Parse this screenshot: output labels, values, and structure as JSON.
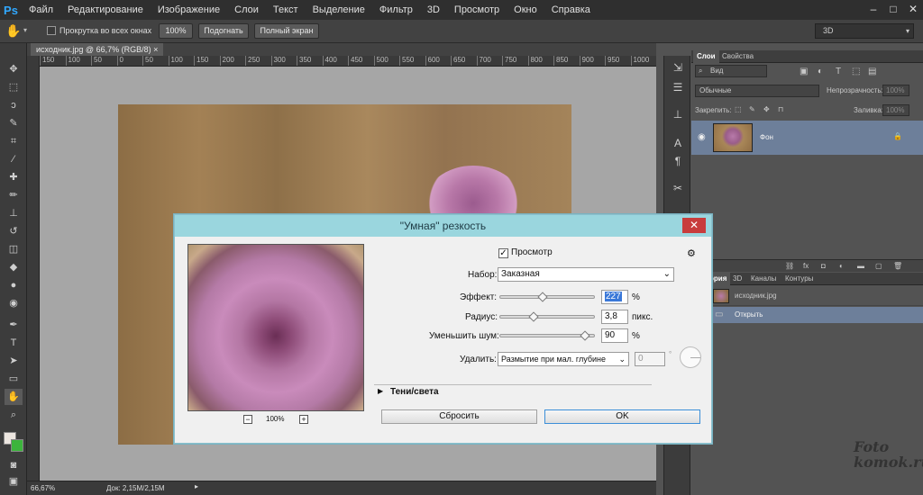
{
  "app": {
    "logo": "Ps"
  },
  "menu": [
    "Файл",
    "Редактирование",
    "Изображение",
    "Слои",
    "Текст",
    "Выделение",
    "Фильтр",
    "3D",
    "Просмотр",
    "Окно",
    "Справка"
  ],
  "window_controls": [
    "‒",
    "□",
    "✕"
  ],
  "options": {
    "scroll_all_label": "Прокрутка во всех окнах",
    "btn_100": "100%",
    "btn_fit": "Подогнать",
    "btn_fullscreen": "Полный экран",
    "workspace": "3D"
  },
  "document": {
    "tab": "исходник.jpg @ 66,7% (RGB/8)"
  },
  "ruler": {
    "ticks": [
      "150",
      "100",
      "50",
      "0",
      "50",
      "100",
      "150",
      "200",
      "250",
      "300",
      "350",
      "400",
      "450",
      "500",
      "550",
      "600",
      "650",
      "700",
      "750",
      "800",
      "850",
      "900",
      "950",
      "1000"
    ]
  },
  "status": {
    "zoom": "66,67%",
    "doc": "Док: 2,15M/2,15M"
  },
  "panels": {
    "layers_tabs": [
      "Слои",
      "Свойства"
    ],
    "kind": "Вид",
    "blend": "Обычные",
    "opacity_label": "Непрозрачность:",
    "opacity_value": "100%",
    "lock_label": "Закрепить:",
    "fill_label": "Заливка:",
    "fill_value": "100%",
    "layer_name": "Фон",
    "history_tabs": [
      "История",
      "3D",
      "Каналы",
      "Контуры"
    ],
    "history_snapshot": "исходник.jpg",
    "history_step": "Открыть"
  },
  "dialog": {
    "title": "\"Умная\" резкость",
    "close": "✕",
    "preview_label": "Просмотр",
    "preset_label": "Набор:",
    "preset_value": "Заказная",
    "amount_label": "Эффект:",
    "amount_value": "227",
    "amount_unit": "%",
    "amount_fraction": 0.45,
    "radius_label": "Радиус:",
    "radius_value": "3,8",
    "radius_unit": "пикс.",
    "radius_fraction": 0.36,
    "noise_label": "Уменьшить шум:",
    "noise_value": "90",
    "noise_unit": "%",
    "noise_fraction": 0.9,
    "remove_label": "Удалить:",
    "remove_value": "Размытие при мал. глубине",
    "angle_value": "0",
    "angle_unit": "°",
    "shadows_label": "Тени/света",
    "reset_label": "Сбросить",
    "ok_label": "OK",
    "zoom_minus": "−",
    "zoom_plus": "+",
    "zoom_value": "100%"
  },
  "watermark": "Foto komok.ru"
}
